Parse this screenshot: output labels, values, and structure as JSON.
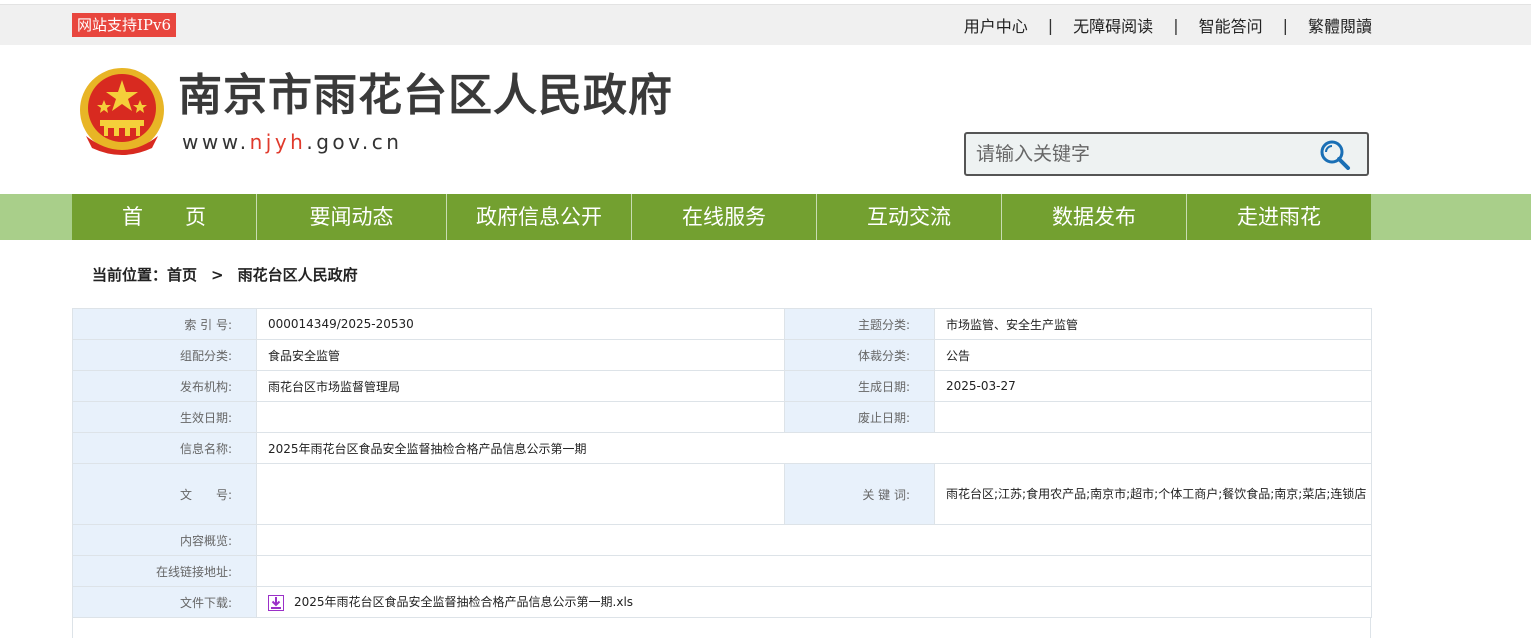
{
  "topbar": {
    "ipv6_badge": "网站支持IPv6",
    "links": [
      "用户中心",
      "无障碍阅读",
      "智能答问",
      "繁體閱讀"
    ],
    "separator": "|"
  },
  "header": {
    "title": "南京市雨花台区人民政府",
    "url_prefix": "www.",
    "url_highlight": "njyh",
    "url_suffix": ".gov.cn",
    "emblem_icon": "national-emblem-icon"
  },
  "search": {
    "placeholder": "请输入关键字",
    "icon": "search-icon"
  },
  "nav": {
    "items": [
      "首　　页",
      "要闻动态",
      "政府信息公开",
      "在线服务",
      "互动交流",
      "数据发布",
      "走进雨花"
    ]
  },
  "breadcrumb": {
    "prefix": "当前位置：",
    "home": "首页",
    "arrow": ">",
    "current": "雨花台区人民政府"
  },
  "info": {
    "index_no_label": "索 引 号:",
    "index_no": "000014349/2025-20530",
    "topic_label": "主题分类:",
    "topic": "市场监管、安全生产监管",
    "category_label": "组配分类:",
    "category": "食品安全监管",
    "genre_label": "体裁分类:",
    "genre": "公告",
    "publisher_label": "发布机构:",
    "publisher": "雨花台区市场监督管理局",
    "created_label": "生成日期:",
    "created": "2025-03-27",
    "effective_label": "生效日期:",
    "effective": "",
    "expiry_label": "废止日期:",
    "expiry": "",
    "name_label": "信息名称:",
    "name": "2025年雨花台区食品安全监督抽检合格产品信息公示第一期",
    "doc_no_label": "文　　号:",
    "doc_no": "",
    "keywords_label": "关 键 词:",
    "keywords": "雨花台区;江苏;食用农产品;南京市;超市;个体工商户;餐饮食品;南京;菜店;连锁店",
    "summary_label": "内容概览:",
    "summary": "",
    "link_label": "在线链接地址:",
    "link": "",
    "download_label": "文件下载:",
    "download_file": "2025年雨花台区食品安全监督抽检合格产品信息公示第一期.xls",
    "download_icon": "download-icon"
  },
  "colors": {
    "nav_bg": "#73a030",
    "nav_outer": "#a9cf8a",
    "badge": "#e8463e",
    "label_bg": "#e8f1fb",
    "url_highlight": "#e03a2c"
  }
}
